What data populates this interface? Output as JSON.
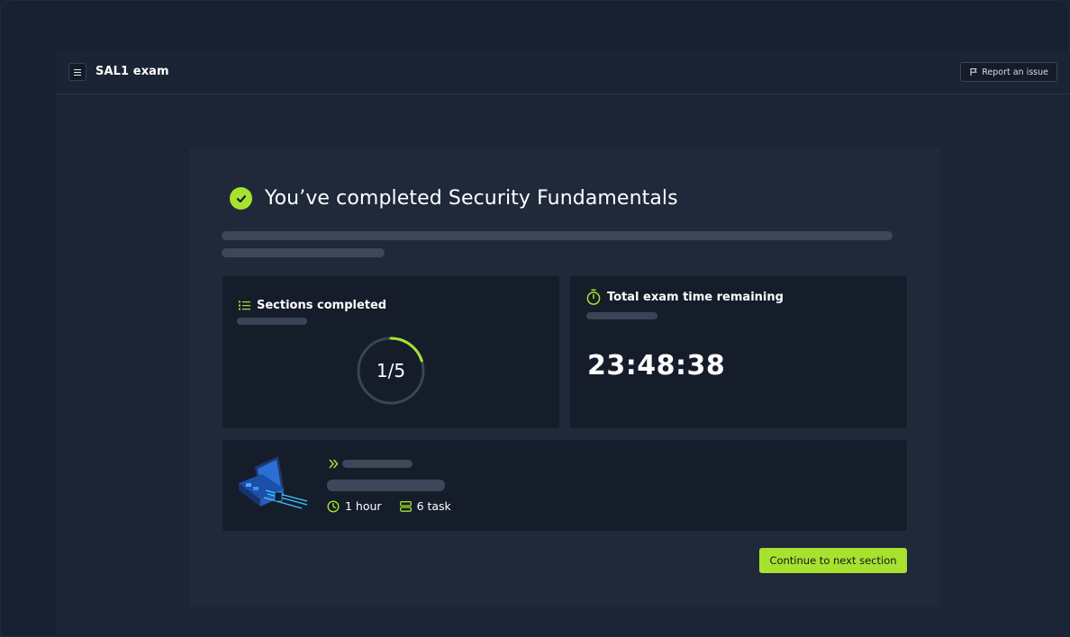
{
  "app": {
    "title": "SAL1 exam",
    "report_label": "Report an issue"
  },
  "completion": {
    "heading": "You’ve completed Security Fundamentals"
  },
  "sections_panel": {
    "title": "Sections completed",
    "progress_text": "1/5",
    "completed": 1,
    "total": 5
  },
  "time_panel": {
    "title": "Total exam time remaining",
    "time_remaining": "23:48:38"
  },
  "next_section": {
    "duration": "1 hour",
    "tasks": "6 task"
  },
  "actions": {
    "continue_label": "Continue to next section"
  },
  "colors": {
    "accent": "#a6e22e",
    "background": "#1c2536",
    "card": "#1f293a",
    "panel": "#151d2b",
    "skeleton": "#3d4759"
  }
}
